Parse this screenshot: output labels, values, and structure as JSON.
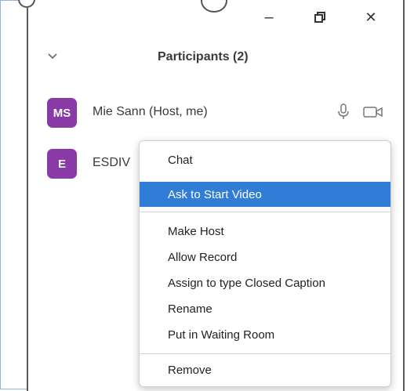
{
  "window": {
    "minimize": "–",
    "restore": "❐",
    "close": "✕"
  },
  "panel": {
    "title": "Participants (2)",
    "collapse_icon": "chevron-down-icon"
  },
  "participants": [
    {
      "initials": "MS",
      "name": "Mie Sann (Host, me)",
      "avatar_color": "#8a3aa6"
    },
    {
      "initials": "E",
      "name": "ESDIV",
      "avatar_color": "#8a3aa6"
    }
  ],
  "context_menu": {
    "items": [
      {
        "label": "Chat"
      },
      {
        "label": "Ask to Start Video",
        "highlighted": true
      },
      {
        "label": "Make Host"
      },
      {
        "label": "Allow Record"
      },
      {
        "label": "Assign to type Closed Caption"
      },
      {
        "label": "Rename"
      },
      {
        "label": "Put in Waiting Room"
      },
      {
        "label": "Remove"
      }
    ],
    "highlight_color": "#2f7dd4"
  }
}
